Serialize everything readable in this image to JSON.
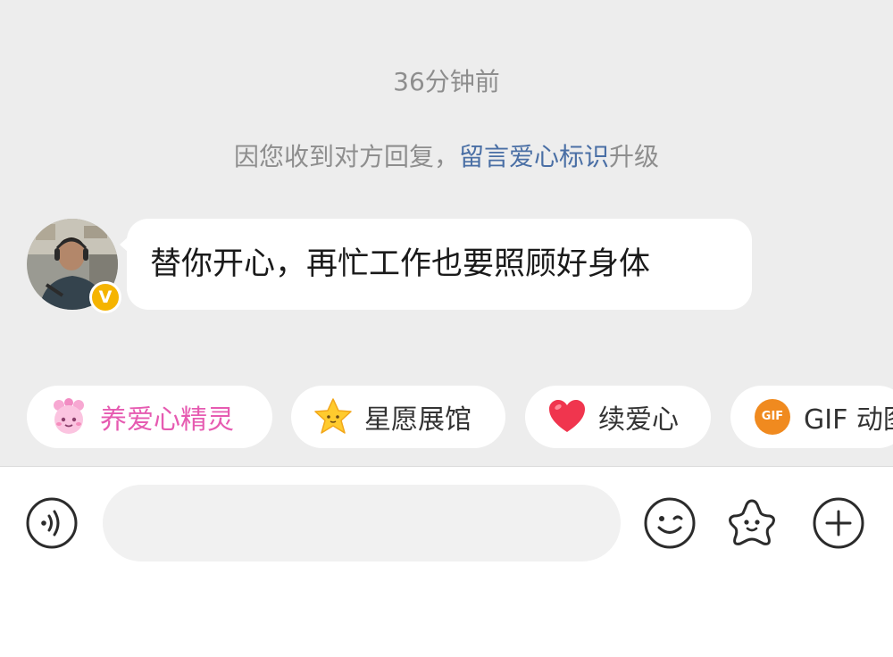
{
  "chat": {
    "timestamp": "36分钟前",
    "notice": {
      "prefix": "因您收到对方回复，",
      "link": "留言爱心标识",
      "suffix": "升级"
    },
    "message": {
      "text": "替你开心，再忙工作也要照顾好身体",
      "badge": "V"
    }
  },
  "chips": [
    {
      "label": "养爱心精灵",
      "icon": "fairy-icon"
    },
    {
      "label": "星愿展馆",
      "icon": "star-icon"
    },
    {
      "label": "续爱心",
      "icon": "heart-icon"
    },
    {
      "label": "GIF 动图",
      "icon": "gif-icon",
      "icon_text": "GIF"
    }
  ],
  "input_bar": {
    "placeholder": "",
    "voice_icon": "voice-icon",
    "emoji_icon": "emoji-icon",
    "sticker_icon": "sticker-icon",
    "plus_icon": "plus-icon"
  },
  "colors": {
    "link": "#4a6fa5",
    "chip_pink": "#e65bb1",
    "vip": "#f5b400",
    "gif": "#f08a1f"
  }
}
